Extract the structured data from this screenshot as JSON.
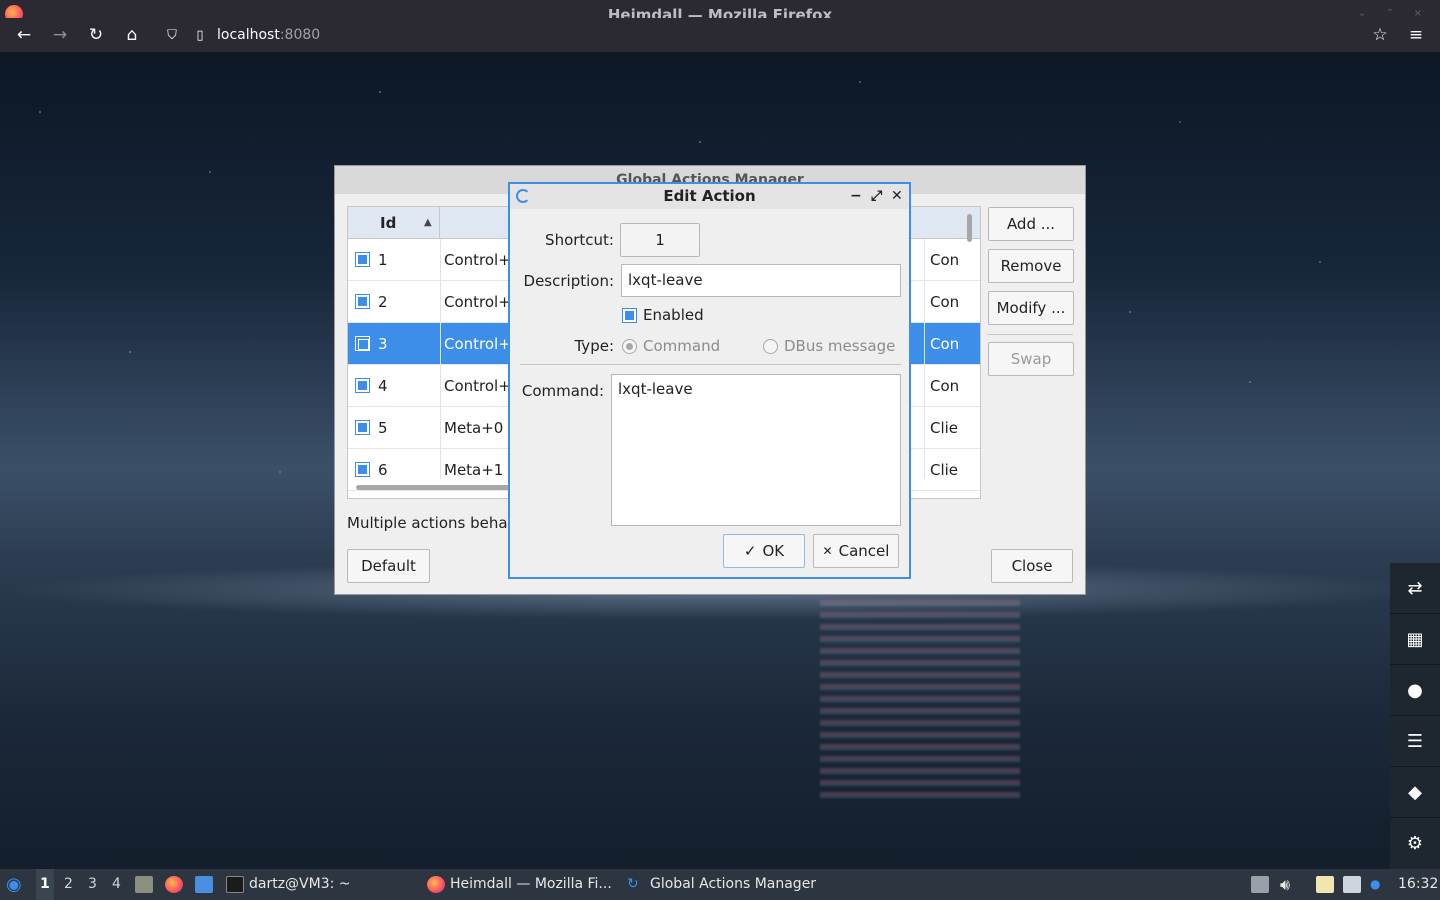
{
  "browser": {
    "window_title": "Heimdall — Mozilla Firefox",
    "url_host": "localhost",
    "url_port": ":8080"
  },
  "gam": {
    "title": "Global Actions Manager",
    "column_id": "Id",
    "rows": [
      {
        "id": "1",
        "shortcut": "Control+",
        "type": "Con",
        "selected": false
      },
      {
        "id": "2",
        "shortcut": "Control+",
        "type": "Con",
        "selected": false
      },
      {
        "id": "3",
        "shortcut": "Control+",
        "type": "Con",
        "selected": true
      },
      {
        "id": "4",
        "shortcut": "Control+",
        "type": "Con",
        "selected": false
      },
      {
        "id": "5",
        "shortcut": "Meta+0",
        "type": "Clie",
        "selected": false
      },
      {
        "id": "6",
        "shortcut": "Meta+1",
        "type": "Clie",
        "selected": false
      }
    ],
    "add_label": "Add ...",
    "remove_label": "Remove",
    "modify_label": "Modify ...",
    "swap_label": "Swap",
    "multiple_label": "Multiple actions beha",
    "default_label": "Default",
    "close_label": "Close"
  },
  "edit": {
    "title": "Edit Action",
    "shortcut_label": "Shortcut:",
    "shortcut_value": "1",
    "description_label": "Description:",
    "description_value": "lxqt-leave",
    "enabled_label": "Enabled",
    "enabled": true,
    "type_label": "Type:",
    "type_command": "Command",
    "type_dbus": "DBus message",
    "command_label": "Command:",
    "command_value": "lxqt-leave",
    "ok_label": "OK",
    "cancel_label": "Cancel"
  },
  "taskbar": {
    "desktops": [
      "1",
      "2",
      "3",
      "4"
    ],
    "active_desktop": "1",
    "terminal_task": "dartz@VM3: ~",
    "firefox_task": "Heimdall — Mozilla Fi...",
    "gam_task": "Global Actions Manager",
    "clock": "16:32"
  },
  "colors": {
    "accent": "#3d8ee9",
    "taskbar_bg": "#2c3540",
    "browser_chrome": "#2b2a33"
  }
}
